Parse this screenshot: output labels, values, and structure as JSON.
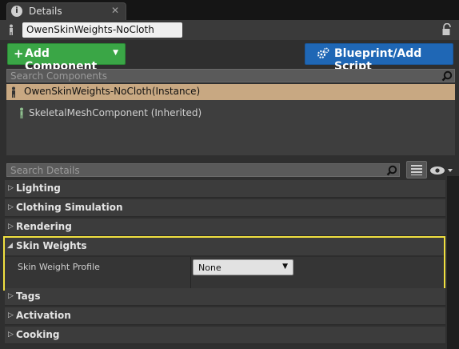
{
  "tab": {
    "title": "Details",
    "icon": "info-icon",
    "close_symbol": "✕"
  },
  "actor": {
    "name": "OwenSkinWeights-NoCloth",
    "lock_icon": "lock-icon"
  },
  "toolbar": {
    "add_component_label": "Add Component",
    "add_component_symbol": "+",
    "blueprint_label": "Blueprint/Add Script",
    "add_color": "#3aa646",
    "blueprint_color": "#1f67b5"
  },
  "components": {
    "search_placeholder": "Search Components",
    "items": [
      {
        "label": "OwenSkinWeights-NoCloth(Instance)",
        "selected": true
      },
      {
        "label": "SkeletalMeshComponent (Inherited)",
        "selected": false
      }
    ]
  },
  "details": {
    "search_placeholder": "Search Details",
    "categories": [
      {
        "label": "Lighting",
        "expanded": false
      },
      {
        "label": "Clothing Simulation",
        "expanded": false
      },
      {
        "label": "Rendering",
        "expanded": false
      }
    ],
    "skin_weights": {
      "label": "Skin Weights",
      "highlight_color": "#f0e040",
      "property_label": "Skin Weight Profile",
      "property_value": "None"
    },
    "categories_after": [
      {
        "label": "Tags",
        "expanded": false
      },
      {
        "label": "Activation",
        "expanded": false
      },
      {
        "label": "Cooking",
        "expanded": false
      }
    ]
  }
}
